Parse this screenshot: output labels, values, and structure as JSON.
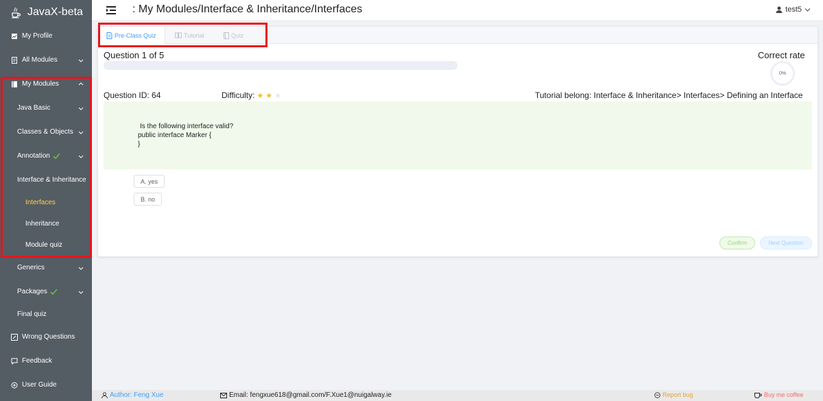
{
  "brand": {
    "name": "JavaX-beta"
  },
  "sidebar": {
    "my_profile": "My Profile",
    "all_modules": "All Modules",
    "my_modules": "My Modules",
    "java_basic": "Java Basic",
    "classes_objects": "Classes & Objects",
    "annotation": "Annotation",
    "interface_inheritance": "Interface & Inheritance",
    "interfaces": "Interfaces",
    "inheritance": "Inheritance",
    "module_quiz": "Module quiz",
    "generics": "Generics",
    "packages": "Packages",
    "final_quiz": "Final quiz",
    "wrong_questions": "Wrong Questions",
    "feedback": "Feedback",
    "user_guide": "User Guide"
  },
  "header": {
    "title": ": My Modules/Interface & Inheritance/Interfaces",
    "user": "test5"
  },
  "tabs": {
    "pre_class_quiz": "Pre-Class Quiz",
    "tutorial": "Tutorial",
    "quiz": "Quiz"
  },
  "quiz": {
    "question_count": "Question 1 of 5",
    "correct_rate_label": "Correct rate",
    "correct_rate_value": "0%",
    "progress_fraction": 0,
    "question_id": "Question ID: 64",
    "difficulty_label": "Difficulty:",
    "difficulty_stars": 2,
    "difficulty_max": 3,
    "tutorial_belong": "Tutorial belong:  Interface & Inheritance> Interfaces> Defining an Interface",
    "question_line1": "Is the following interface valid?",
    "question_line2": "public interface Marker {",
    "question_line3": "}",
    "option_a": "A. yes",
    "option_b": "B. no",
    "confirm": "Confirm",
    "next_question": "Next Question"
  },
  "footer": {
    "author": "Author: Feng Xue",
    "email": "Email: fengxue618@gmail.com/F.Xue1@nuigalway.ie",
    "report_bug": "Report bug",
    "buy_coffee": "Buy me coffee"
  },
  "colors": {
    "sidebar_bg": "#545c64",
    "active_text": "#ffd04b",
    "highlight": "#e8141c",
    "tab_active": "#409eff",
    "star": "#f7ba2a",
    "question_bg": "#f0f9eb",
    "report_bug": "#e6a23c",
    "buy_coffee": "#f56c6c"
  }
}
